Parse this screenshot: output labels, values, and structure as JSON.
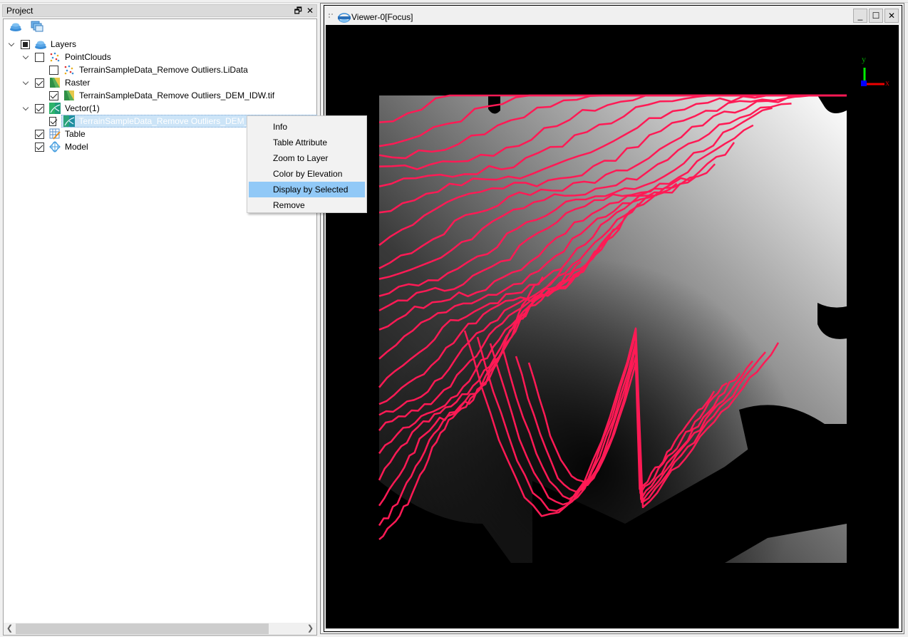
{
  "project_panel": {
    "title": "Project",
    "float_icon": "float-icon",
    "close_icon": "close-icon",
    "toolbar": [
      {
        "icon": "layers-stack-icon"
      },
      {
        "icon": "windows-icon"
      }
    ],
    "tree": [
      {
        "label": "Layers",
        "level": 0,
        "expanded": true,
        "check": "partial",
        "icon": "layers-icon"
      },
      {
        "label": "PointClouds",
        "level": 1,
        "expanded": true,
        "check": "unchecked",
        "icon": "pointcloud-icon"
      },
      {
        "label": "TerrainSampleData_Remove Outliers.LiData",
        "level": 2,
        "check": "unchecked",
        "icon": "pointcloud-icon"
      },
      {
        "label": "Raster",
        "level": 1,
        "expanded": true,
        "check": "checked",
        "icon": "raster-icon"
      },
      {
        "label": "TerrainSampleData_Remove Outliers_DEM_IDW.tif",
        "level": 2,
        "check": "checked",
        "icon": "raster-icon"
      },
      {
        "label": "Vector(1)",
        "level": 1,
        "expanded": true,
        "check": "checked",
        "icon": "vector-icon"
      },
      {
        "label": "TerrainSampleData_Remove Outliers_DEM_IDW_Contour.shp",
        "level": 2,
        "check": "checked",
        "icon": "vector-icon",
        "selected": true
      },
      {
        "label": "Table",
        "level": 1,
        "check": "checked",
        "icon": "table-icon"
      },
      {
        "label": "Model",
        "level": 1,
        "check": "checked",
        "icon": "model-icon"
      }
    ]
  },
  "context_menu": {
    "items": [
      {
        "label": "Info"
      },
      {
        "label": "Table Attribute"
      },
      {
        "label": "Zoom to Layer"
      },
      {
        "label": "Color by Elevation"
      },
      {
        "label": "Display by Selected",
        "highlighted": true
      },
      {
        "label": "Remove"
      }
    ]
  },
  "viewer": {
    "title": "Viewer-0[Focus]",
    "minimize": "_",
    "maximize": "☐",
    "close": "✕",
    "axis": {
      "x_label": "x",
      "y_label": "y"
    },
    "contour_color": "#ff1a55"
  },
  "colors": {
    "selection_bg": "#cce4f7",
    "menu_highlight": "#91c9f7"
  }
}
